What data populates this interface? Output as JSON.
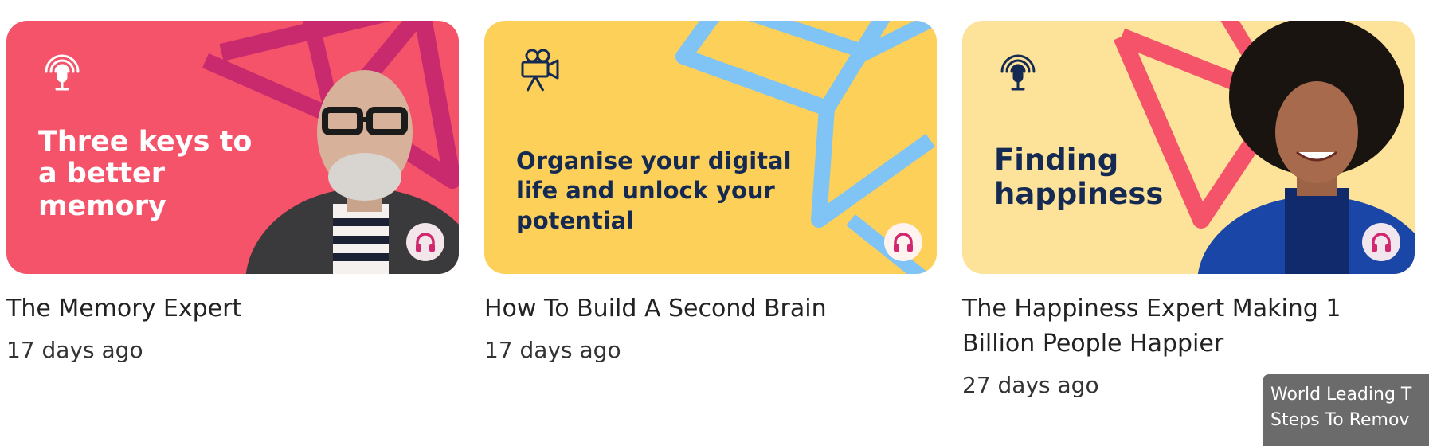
{
  "cards": [
    {
      "thumbnail_text_lines": [
        "Three keys to",
        "a better",
        "memory"
      ],
      "thumbnail_icon": "podcast-mic-icon",
      "thumbnail_bg": "#f4536a",
      "accent": "#d1276f",
      "title": "The Memory Expert",
      "age": "17 days ago",
      "play_icon": "headphones-icon"
    },
    {
      "thumbnail_text_lines": [
        "Organise your digital",
        "life and unlock your",
        "potential"
      ],
      "thumbnail_icon": "video-camera-icon",
      "thumbnail_bg": "#fdd05a",
      "accent": "#7fc4f5",
      "title": "How To Build A Second Brain",
      "age": "17 days ago",
      "play_icon": "headphones-icon"
    },
    {
      "thumbnail_text_lines": [
        "Finding",
        "happiness"
      ],
      "thumbnail_icon": "podcast-mic-icon",
      "thumbnail_bg": "#fde39a",
      "accent": "#f4536a",
      "title_lines": [
        "The Happiness Expert Making 1",
        "Billion People Happier"
      ],
      "age": "27 days ago",
      "play_icon": "headphones-icon"
    }
  ],
  "tooltip_lines": [
    "World Leading T",
    "Steps To Remov"
  ],
  "colors": {
    "play_button_bg": "#f3e6ea",
    "play_icon": "#d1276f",
    "navy_text": "#152a53"
  }
}
